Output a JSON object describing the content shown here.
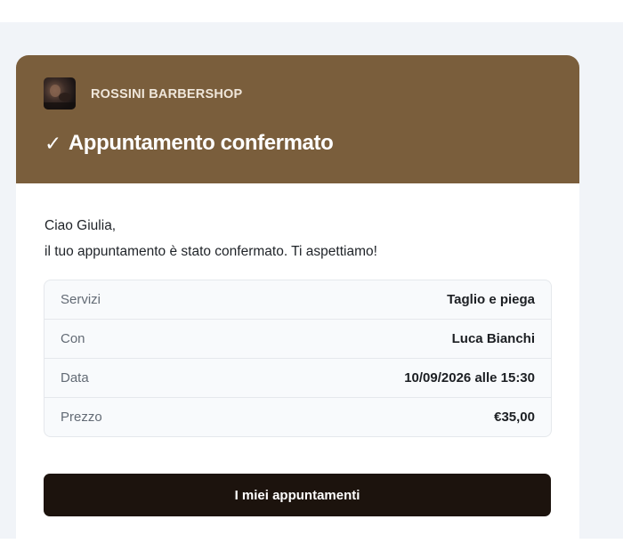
{
  "header": {
    "brand": "ROSSINI BARBERSHOP",
    "check": "✓",
    "title": "Appuntamento confermato"
  },
  "message": {
    "greeting": "Ciao Giulia,",
    "body": "il tuo appuntamento è stato confermato. Ti aspettiamo!"
  },
  "details": [
    {
      "label": "Servizi",
      "value": "Taglio e piega"
    },
    {
      "label": "Con",
      "value": "Luca Bianchi"
    },
    {
      "label": "Data",
      "value": "10/09/2026 alle 15:30"
    },
    {
      "label": "Prezzo",
      "value": "€35,00"
    }
  ],
  "cta": {
    "label": "I miei appuntamenti"
  },
  "colors": {
    "header_bg": "#7a5e3c",
    "button_bg": "#1c130d",
    "page_bg": "#f1f4f8"
  },
  "icons": {
    "logo": "barbershop-logo",
    "check": "checkmark-icon"
  }
}
